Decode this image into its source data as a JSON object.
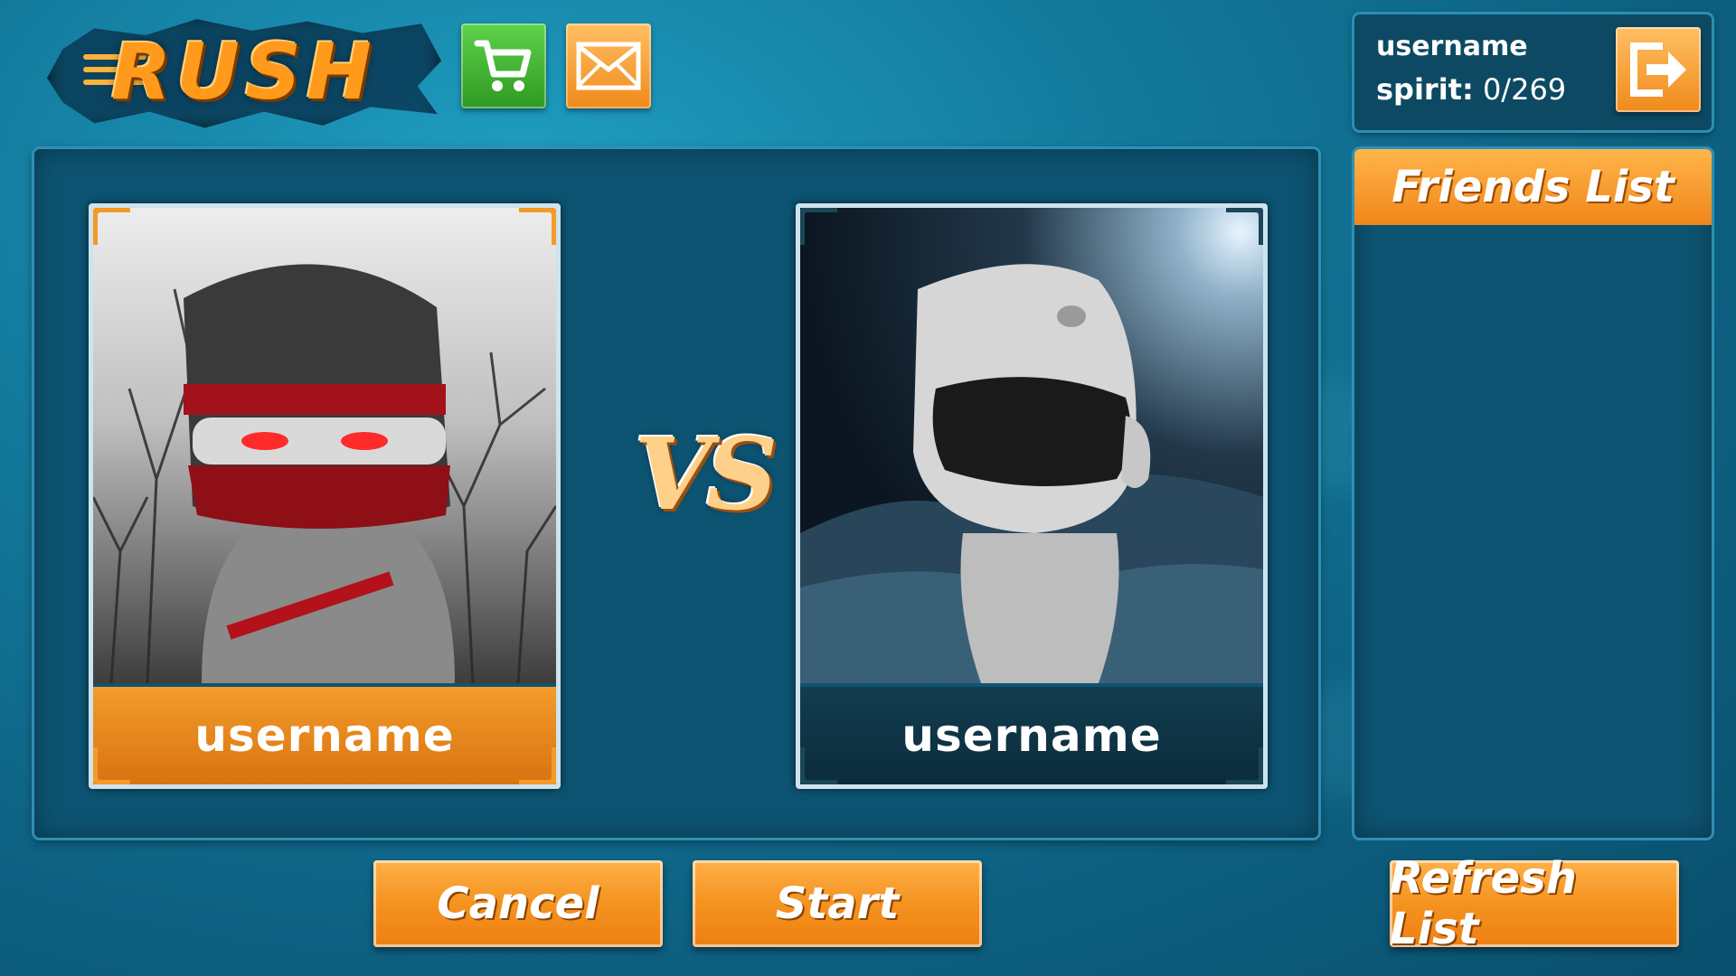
{
  "header": {
    "logo_text": "RUSH",
    "shop_icon": "cart-icon",
    "mail_icon": "envelope-icon"
  },
  "user": {
    "name": "username",
    "spirit_label": "spirit:",
    "spirit_value": "0/269",
    "logout_icon": "exit-icon"
  },
  "match": {
    "player_left": {
      "name": "username",
      "character": "ninja"
    },
    "player_right": {
      "name": "username",
      "character": "astronaut"
    },
    "vs_text": "VS"
  },
  "friends": {
    "title": "Friends List",
    "items": []
  },
  "buttons": {
    "cancel": "Cancel",
    "start": "Start",
    "refresh": "Refresh List"
  },
  "colors": {
    "accent_orange": "#f4931f",
    "panel_blue": "#0d5473",
    "shop_green": "#3fb22e"
  }
}
